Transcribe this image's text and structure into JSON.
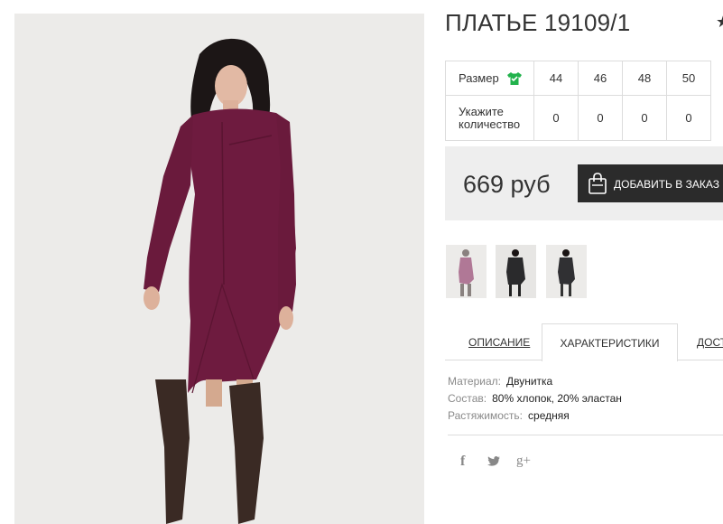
{
  "product": {
    "title": "ПЛАТЬЕ 19109/1",
    "favorite_icon": "star-icon",
    "photo_alt": "photo"
  },
  "size_table": {
    "size_label": "Размер",
    "size_icon": "shirt-icon",
    "quantity_label_line1": "Укажите",
    "quantity_label_line2": "количество",
    "sizes": [
      "44",
      "46",
      "48",
      "50"
    ],
    "quantities": [
      "0",
      "0",
      "0",
      "0"
    ]
  },
  "purchase": {
    "price": "669 руб",
    "add_to_cart_label": "ДОБАВИТЬ В ЗАКАЗ",
    "cart_icon": "shopping-bag-icon"
  },
  "thumbnails": [
    {
      "name": "thumbnail-1"
    },
    {
      "name": "thumbnail-2"
    },
    {
      "name": "thumbnail-3"
    }
  ],
  "tabs": {
    "description": "ОПИСАНИЕ",
    "characteristics": "ХАРАКТЕРИСТИКИ",
    "delivery": "ДОСТАВКА"
  },
  "specs": [
    {
      "key": "Материал:",
      "value": "Двунитка"
    },
    {
      "key": "Состав:",
      "value": "80% хлопок, 20% эластан"
    },
    {
      "key": "Растяжимость:",
      "value": "средняя"
    }
  ],
  "social": {
    "facebook": "f",
    "twitter_icon": "twitter-icon",
    "google_plus": "g+"
  },
  "colors": {
    "dress": "#6e1b3f",
    "button": "#2b2b2b",
    "size_icon": "#22b24c",
    "panel": "#eeeeee"
  }
}
